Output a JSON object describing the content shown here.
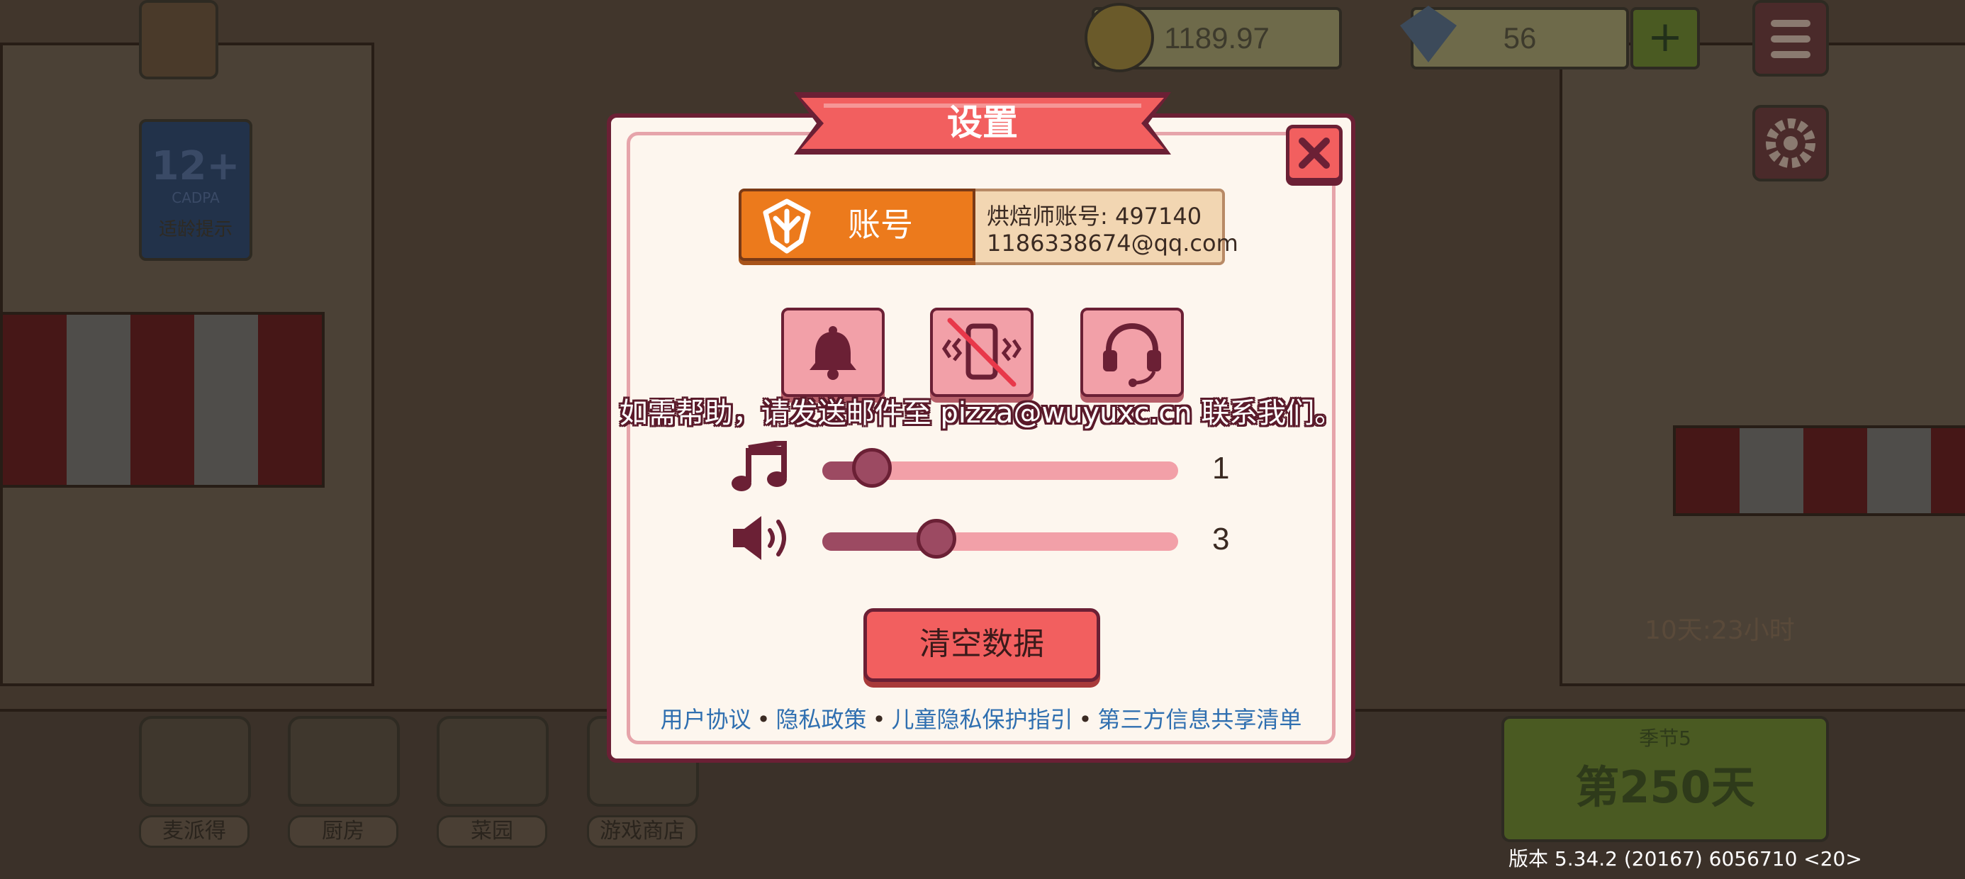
{
  "hud": {
    "coins": "1189.97",
    "gems": "56",
    "age_badge_number": "12+",
    "age_badge_caption": "CADPA",
    "age_badge_label": "适龄提示",
    "timer": "10天:23小时",
    "season_label": "季节5",
    "day_label": "第250天"
  },
  "nav": {
    "items": [
      {
        "label": "麦派得"
      },
      {
        "label": "厨房"
      },
      {
        "label": "菜园"
      },
      {
        "label": "游戏商店"
      }
    ]
  },
  "dialog": {
    "title": "设置",
    "close_glyph": "✕",
    "account": {
      "button_label": "账号",
      "baker_id": "烘焙师账号: 497140",
      "email": "1186338674@qq.com"
    },
    "toggles": [
      {
        "icon": "bell-icon",
        "state": "on"
      },
      {
        "icon": "vibration-icon",
        "state": "off"
      },
      {
        "icon": "headset-icon",
        "state": "on"
      }
    ],
    "help_text": "如需帮助，请发送邮件至  pizza@wuyuxc.cn  联系我们。",
    "music": {
      "icon": "music-note-icon",
      "value": "1",
      "level": 0.14
    },
    "sound": {
      "icon": "speaker-icon",
      "value": "3",
      "level": 0.32
    },
    "clear_data_label": "清空数据",
    "links": {
      "user_agreement": "用户协议",
      "privacy_policy": "隐私政策",
      "child_privacy": "儿童隐私保护指引",
      "third_party": "第三方信息共享清单",
      "separator": "•"
    }
  },
  "version": "版本  5.34.2 (20167) 6056710  <20>",
  "colors": {
    "ribbon": "#f25f5f",
    "account_orange": "#ec7a1c",
    "dialog_bg": "#fdf6ee",
    "border_dark": "#6b2035",
    "link_blue": "#2f6fb0"
  }
}
